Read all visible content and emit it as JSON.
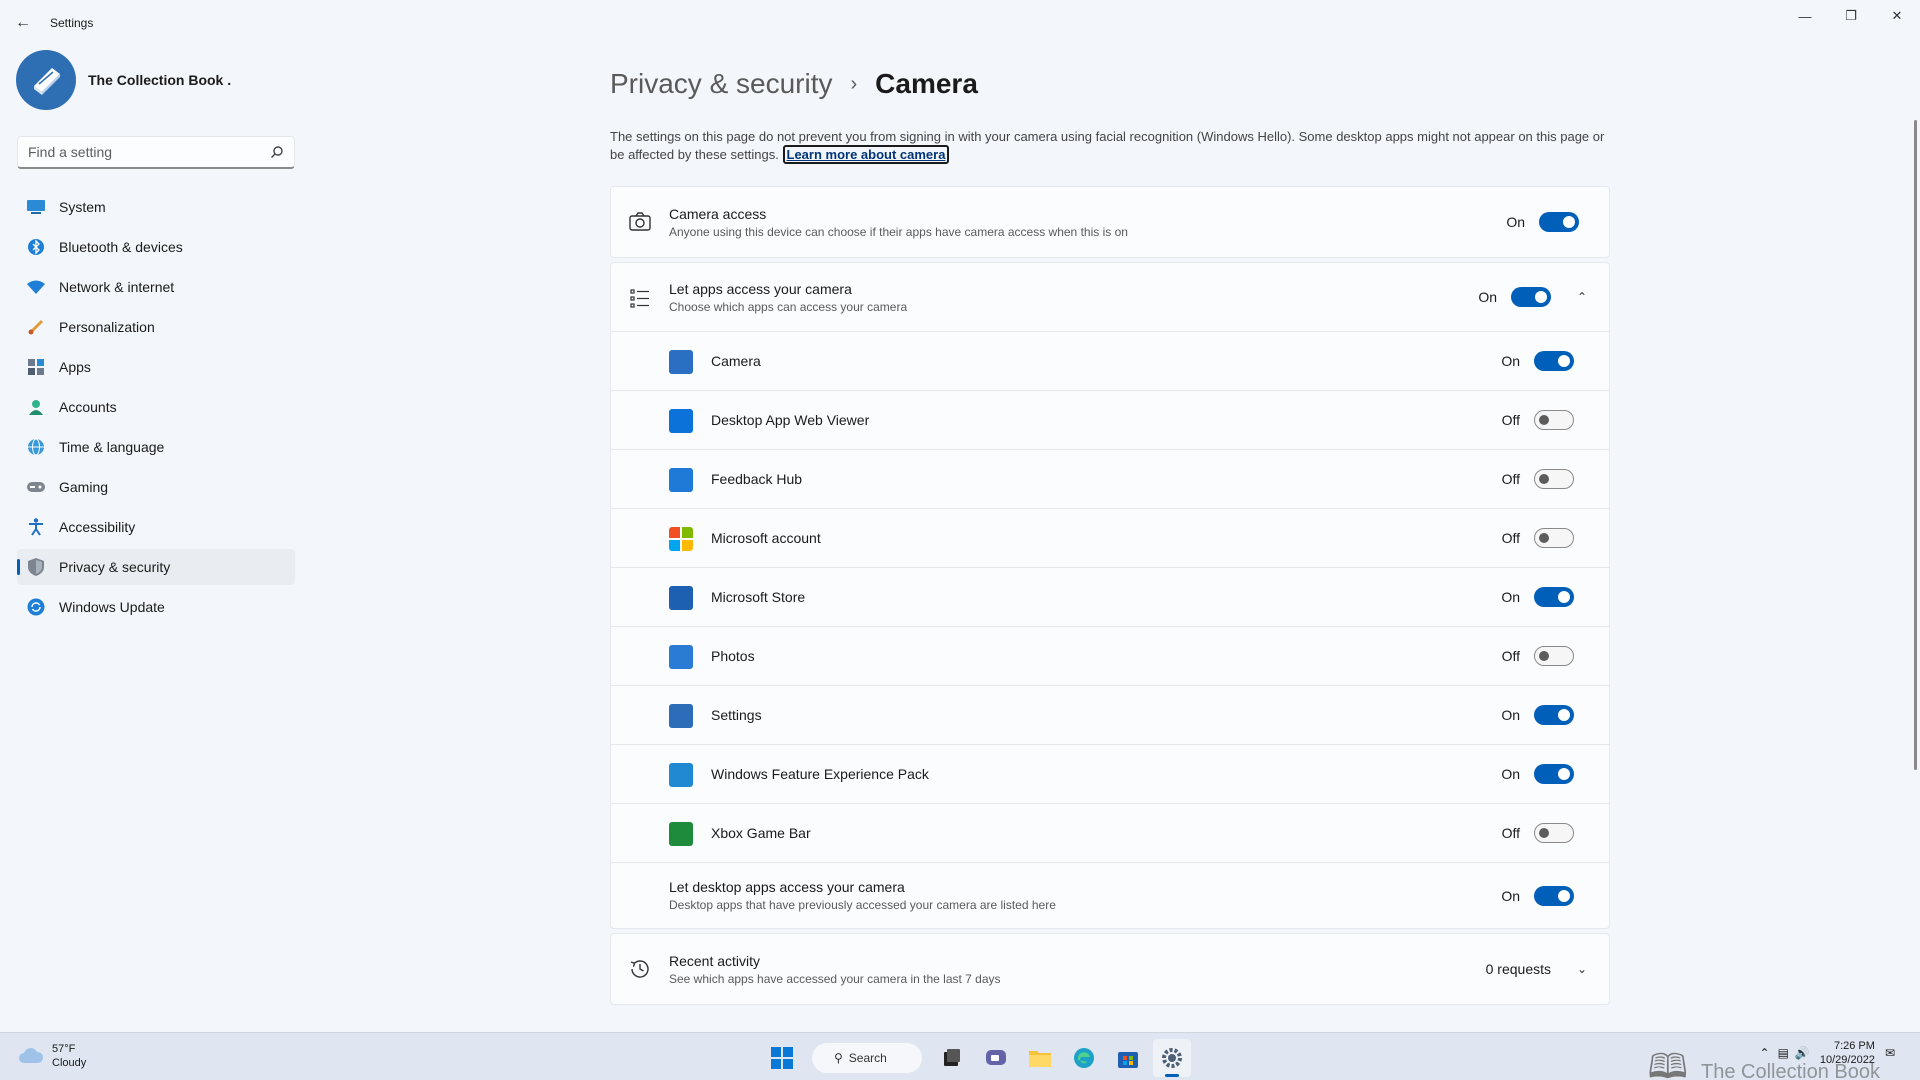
{
  "window": {
    "title": "Settings"
  },
  "profile": {
    "name": "The Collection Book ."
  },
  "search": {
    "placeholder": "Find a setting"
  },
  "nav": {
    "items": [
      {
        "label": "System",
        "icon": "system-icon"
      },
      {
        "label": "Bluetooth & devices",
        "icon": "bluetooth-icon"
      },
      {
        "label": "Network & internet",
        "icon": "network-icon"
      },
      {
        "label": "Personalization",
        "icon": "brush-icon"
      },
      {
        "label": "Apps",
        "icon": "apps-icon"
      },
      {
        "label": "Accounts",
        "icon": "accounts-icon"
      },
      {
        "label": "Time & language",
        "icon": "globe-icon"
      },
      {
        "label": "Gaming",
        "icon": "controller-icon"
      },
      {
        "label": "Accessibility",
        "icon": "accessibility-icon"
      },
      {
        "label": "Privacy & security",
        "icon": "shield-icon",
        "active": true
      },
      {
        "label": "Windows Update",
        "icon": "update-icon"
      }
    ]
  },
  "breadcrumb": {
    "parent": "Privacy & security",
    "separator": "›",
    "current": "Camera"
  },
  "description": {
    "text": "The settings on this page do not prevent you from signing in with your camera using facial recognition (Windows Hello). Some desktop apps might not appear on this page or be affected by these settings.",
    "link": "Learn more about camera"
  },
  "camera_access": {
    "title": "Camera access",
    "subtitle": "Anyone using this device can choose if their apps have camera access when this is on",
    "state": "On"
  },
  "apps_access": {
    "title": "Let apps access your camera",
    "subtitle": "Choose which apps can access your camera",
    "state": "On",
    "apps": [
      {
        "name": "Camera",
        "state": "On",
        "color": "#2b6fc2"
      },
      {
        "name": "Desktop App Web Viewer",
        "state": "Off",
        "color": "#0a72d8"
      },
      {
        "name": "Feedback Hub",
        "state": "Off",
        "color": "#1f79d6"
      },
      {
        "name": "Microsoft account",
        "state": "Off",
        "color": "#f25022"
      },
      {
        "name": "Microsoft Store",
        "state": "On",
        "color": "#1d5fb0"
      },
      {
        "name": "Photos",
        "state": "Off",
        "color": "#2a7bd3"
      },
      {
        "name": "Settings",
        "state": "On",
        "color": "#2c6cb8"
      },
      {
        "name": "Windows Feature Experience Pack",
        "state": "On",
        "color": "#1f8ad2"
      },
      {
        "name": "Xbox Game Bar",
        "state": "Off",
        "color": "#1d8a3c"
      }
    ]
  },
  "desktop_access": {
    "title": "Let desktop apps access your camera",
    "subtitle": "Desktop apps that have previously accessed your camera are listed here",
    "state": "On"
  },
  "recent_activity": {
    "title": "Recent activity",
    "subtitle": "See which apps have accessed your camera in the last 7 days",
    "value": "0 requests"
  },
  "taskbar": {
    "weather_temp": "57°F",
    "weather_desc": "Cloudy",
    "search_label": "Search",
    "time": "7:26 PM",
    "date": "10/29/2022",
    "watermark": "The Collection Book"
  },
  "colors": {
    "accent": "#005fb8"
  }
}
